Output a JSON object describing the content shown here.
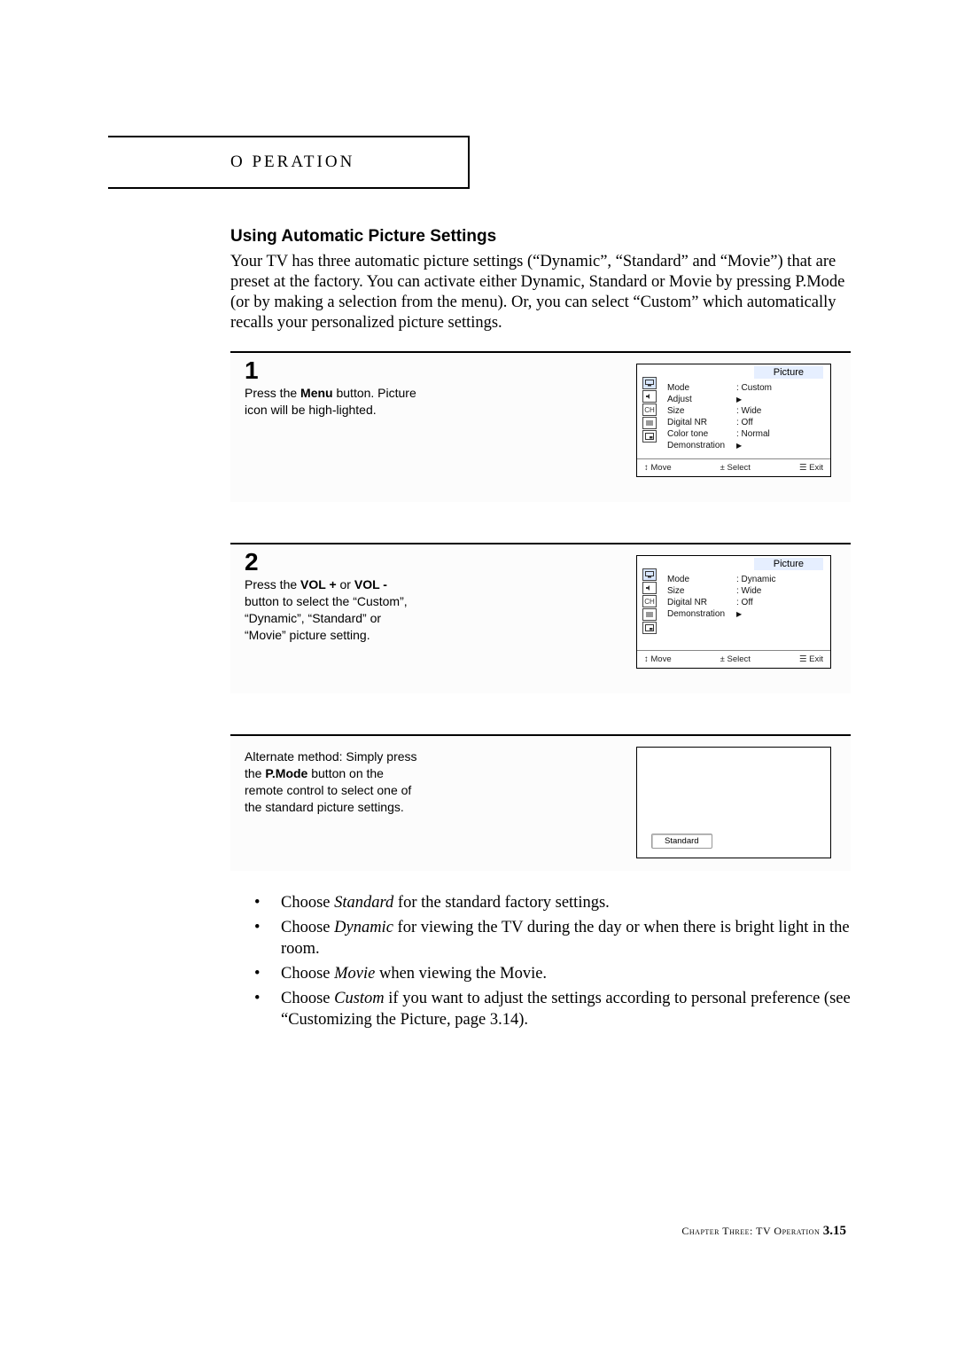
{
  "header": {
    "operation": "O PERATION"
  },
  "section_title": "Using Automatic Picture Settings",
  "intro": "Your TV has three automatic picture settings (“Dynamic”, “Standard” and “Movie”) that are preset at the factory.  You can activate either Dynamic, Standard or Movie by pressing P.Mode (or by making a selection from the menu). Or, you can select “Custom” which automatically recalls your personalized picture settings.",
  "step1": {
    "num": "1",
    "pre": "Press the ",
    "bold1": "Menu",
    "post": " button. Picture icon will be high-lighted."
  },
  "step2": {
    "num": "2",
    "pre": "Press the ",
    "bold1": "VOL +",
    "mid1": " or ",
    "bold2": "VOL -",
    "post": " button to select the “Custom”, “Dynamic”, “Standard” or “Movie” picture setting."
  },
  "step3": {
    "pre": "Alternate method: Simply press the ",
    "bold1": "P.Mode",
    "post": " button on the remote control to select one of the standard picture settings."
  },
  "osd1": {
    "title": "Picture",
    "rows": [
      {
        "k": "Mode",
        "v": ": Custom"
      },
      {
        "k": "Adjust",
        "v": "tri"
      },
      {
        "k": "Size",
        "v": ": Wide"
      },
      {
        "k": "Digital NR",
        "v": ": Off"
      },
      {
        "k": "Color tone",
        "v": ": Normal"
      },
      {
        "k": "Demonstration",
        "v": "tri"
      }
    ],
    "foot": {
      "move": "↕ Move",
      "select": "± Select",
      "exit": "☰ Exit"
    }
  },
  "osd2": {
    "title": "Picture",
    "rows": [
      {
        "k": "Mode",
        "v": ": Dynamic"
      },
      {
        "k": "Size",
        "v": ": Wide"
      },
      {
        "k": "Digital NR",
        "v": ": Off"
      },
      {
        "k": "Demonstration",
        "v": "tri"
      }
    ],
    "foot": {
      "move": "↕ Move",
      "select": "± Select",
      "exit": "☰ Exit"
    }
  },
  "osd3": {
    "label": "Standard"
  },
  "bullets": [
    {
      "pre": "Choose ",
      "it": "Standard",
      "post": " for the standard factory settings."
    },
    {
      "pre": "Choose ",
      "it": "Dynamic",
      "post": " for viewing the TV during the day or when there is bright light in the room."
    },
    {
      "pre": "Choose ",
      "it": "Movie",
      "post": " when viewing the Movie."
    },
    {
      "pre": "Choose ",
      "it": "Custom",
      "post": " if you want to adjust the settings according to personal preference (see “Customizing the Picture, page 3.14)."
    }
  ],
  "footer": {
    "sc": "Chapter Three: TV Operation ",
    "page": "3.15"
  }
}
